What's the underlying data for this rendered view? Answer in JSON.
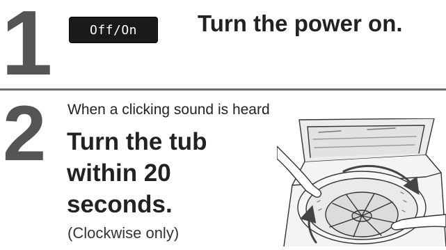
{
  "step1": {
    "number": "1",
    "key_label": "Off/On",
    "title": "Turn the power on."
  },
  "step2": {
    "number": "2",
    "condition": "When a clicking sound is heard",
    "title_lines": [
      "Turn the tub",
      "within 20",
      "seconds."
    ],
    "note": "(Clockwise only)"
  },
  "illustration": {
    "icon": "washing-machine-tub-rotation-icon"
  }
}
